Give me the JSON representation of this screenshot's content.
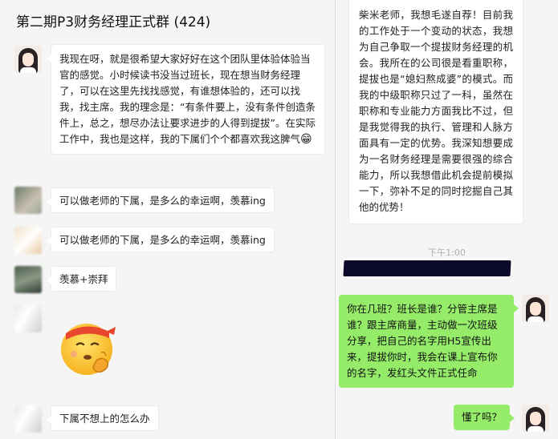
{
  "left_panel": {
    "title": "第二期P3财务经理正式群 (424)",
    "messages": [
      {
        "text": "我现在呀，就是很希望大家好好在这个团队里体验体验当官的感觉。小时候读书没当过班长，现在想当财务经理了，可以在这里先找找感觉，有谁想体验的，还可以找我，找主席。我的理念是：“有条件要上，没有条件创造条件上，总之，想尽办法让要求进步的人得到提拔”。在实际工作中，我也是这样，我的下属们个个都喜欢我这脾气",
        "emoji": "😁"
      },
      {
        "text": "可以做老师的下属，是多么的幸运啊，羡慕ing"
      },
      {
        "text": "可以做老师的下属，是多么的幸运啊，羡慕ing"
      },
      {
        "text": "羡慕+崇拜"
      },
      {
        "sticker": "thinking-emoji-sticker"
      },
      {
        "text": "下属不想上的怎么办"
      }
    ]
  },
  "right_panel": {
    "incoming_message": "柴米老师，我想毛遂自荐！目前我的工作处于一个变动的状态，我想为自己争取一个提拔财务经理的机会。我所在的公司很是看重职称，提拔也是“媳妇熬成婆”的模式。而我的中级职称只过了一科，虽然在职称和专业能力方面我比不过，但是我觉得我的执行、管理和人脉方面具有一定的优势。我深知想要成为一名财务经理是需要很强的综合能力，所以我想借此机会提前模拟一下，弥补不足的同时挖掘自己其他的优势！",
    "timestamp": "下午1:00",
    "outgoing_messages": [
      "你在几班？班长是谁？分管主席是谁？跟主席商量，主动做一次班级分享，把自己的名字用H5宣传出来，提拔你时，我会在课上宣布你的名字，发红头文件正式任命",
      "懂了吗？"
    ]
  },
  "colors": {
    "outgoing_bubble": "#95ec69",
    "incoming_bubble": "#ffffff",
    "chat_background": "#f5f5f5",
    "redaction": "#0c0a2b"
  }
}
